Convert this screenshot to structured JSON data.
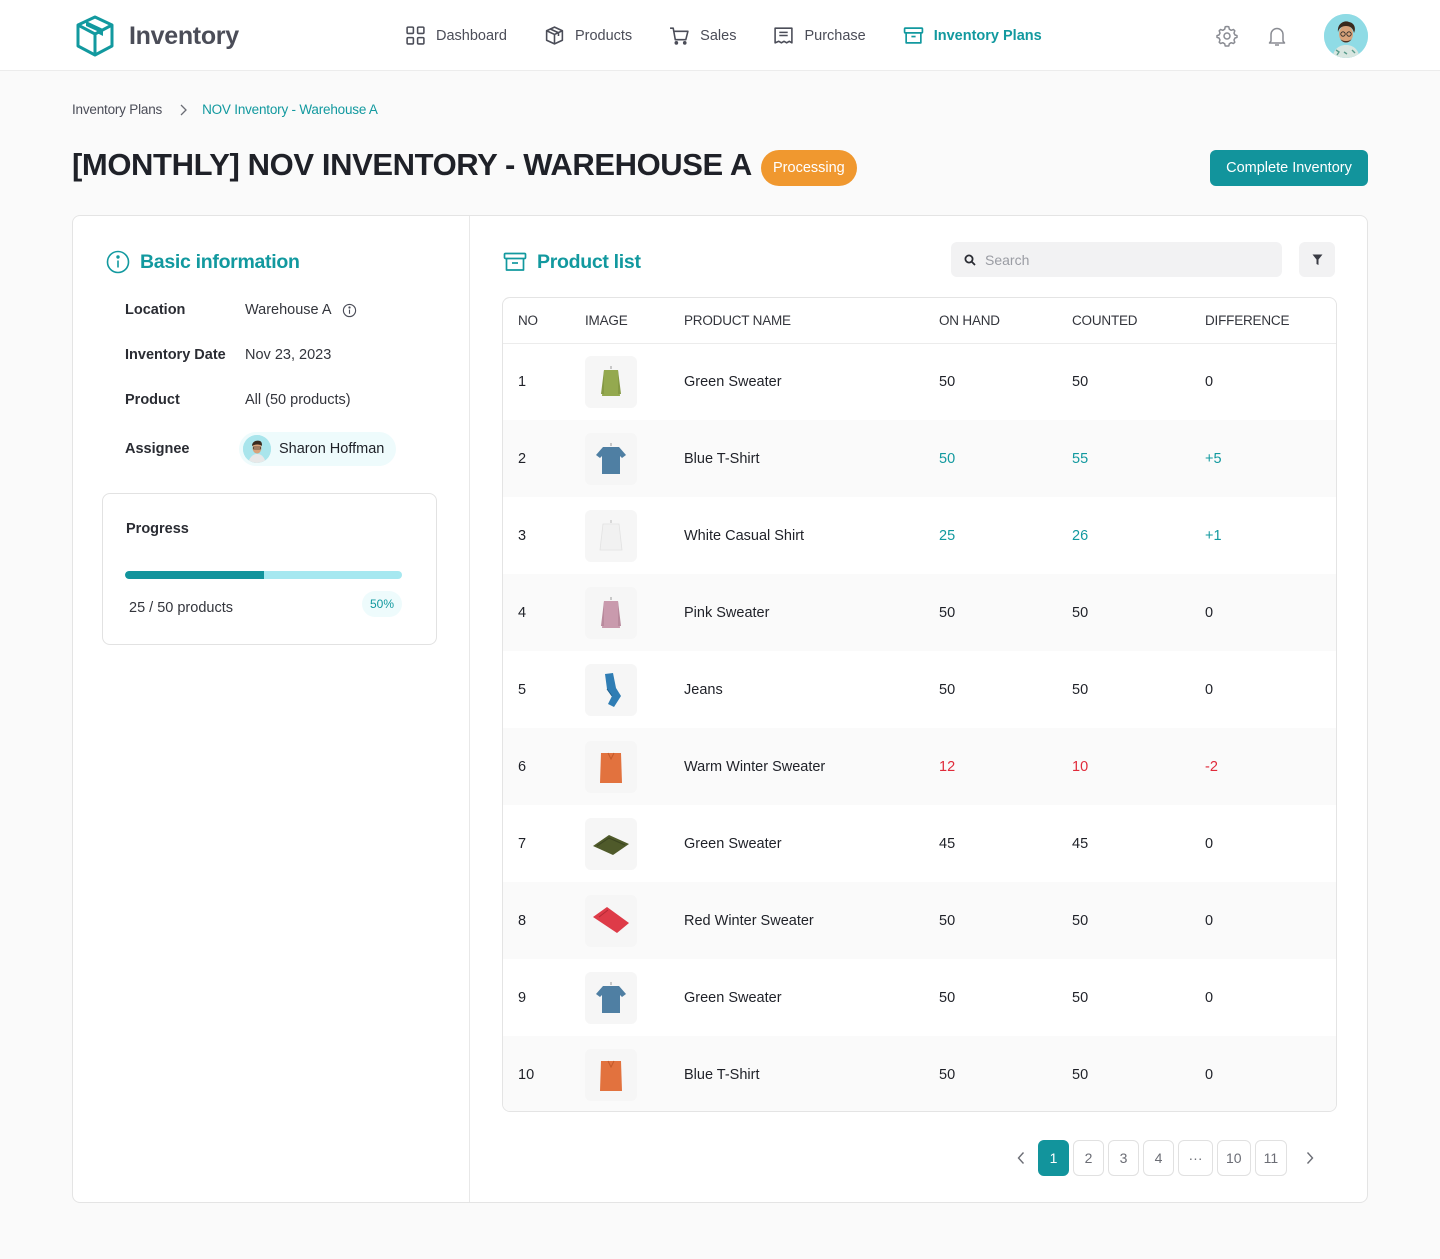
{
  "app": {
    "title": "Inventory",
    "brand_color": "#12999f"
  },
  "nav": {
    "items": [
      {
        "label": "Dashboard",
        "icon": "grid-icon",
        "active": false
      },
      {
        "label": "Products",
        "icon": "box-icon",
        "active": false
      },
      {
        "label": "Sales",
        "icon": "cart-icon",
        "active": false
      },
      {
        "label": "Purchase",
        "icon": "receipt-icon",
        "active": false
      },
      {
        "label": "Inventory Plans",
        "icon": "archive-icon",
        "active": true
      }
    ],
    "settings_icon": "gear-icon",
    "notifications_icon": "bell-icon",
    "user_avatar": "avatar"
  },
  "breadcrumb": {
    "items": [
      "Inventory Plans",
      "NOV Inventory - Warehouse A"
    ]
  },
  "header": {
    "title": "[MONTHLY] NOV INVENTORY - WAREHOUSE A",
    "status": "Processing",
    "status_color": "#f0982f",
    "action_label": "Complete Inventory"
  },
  "basic_info": {
    "title": "Basic information",
    "fields": [
      {
        "label": "Location",
        "value": "Warehouse A"
      },
      {
        "label": "Inventory Date",
        "value": "Nov 23, 2023"
      },
      {
        "label": "Product",
        "value": "All (50 products)"
      },
      {
        "label": "Assignee",
        "value": "Sharon Hoffman"
      }
    ],
    "progress": {
      "title": "Progress",
      "done": 25,
      "total": 50,
      "text": "25 / 50 products",
      "percent_label": "50%",
      "fraction": 0.5
    }
  },
  "product_list": {
    "title": "Product list",
    "search_placeholder": "Search",
    "columns": [
      "NO",
      "IMAGE",
      "PRODUCT NAME",
      "ON HAND",
      "COUNTED",
      "DIFFERENCE"
    ],
    "rows": [
      {
        "no": "1",
        "image": "green-sweater-hanging",
        "name": "Green Sweater",
        "on_hand": "50",
        "counted": "50",
        "difference": "0",
        "state": "neutral"
      },
      {
        "no": "2",
        "image": "blue-tshirt-hanging",
        "name": "Blue T-Shirt",
        "on_hand": "50",
        "counted": "55",
        "difference": "+5",
        "state": "pos"
      },
      {
        "no": "3",
        "image": "white-shirt-hanging",
        "name": "White Casual Shirt",
        "on_hand": "25",
        "counted": "26",
        "difference": "+1",
        "state": "pos"
      },
      {
        "no": "4",
        "image": "pink-sweater-hanging",
        "name": "Pink Sweater",
        "on_hand": "50",
        "counted": "50",
        "difference": "0",
        "state": "neutral"
      },
      {
        "no": "5",
        "image": "jeans-folded",
        "name": "Jeans",
        "on_hand": "50",
        "counted": "50",
        "difference": "0",
        "state": "neutral"
      },
      {
        "no": "6",
        "image": "orange-sweater-folded",
        "name": "Warm Winter Sweater",
        "on_hand": "12",
        "counted": "10",
        "difference": "-2",
        "state": "neg"
      },
      {
        "no": "7",
        "image": "green-sweater-folded",
        "name": "Green Sweater",
        "on_hand": "45",
        "counted": "45",
        "difference": "0",
        "state": "neutral"
      },
      {
        "no": "8",
        "image": "red-sweater-folded",
        "name": "Red Winter Sweater",
        "on_hand": "50",
        "counted": "50",
        "difference": "0",
        "state": "neutral"
      },
      {
        "no": "9",
        "image": "blue-tshirt-hanging",
        "name": "Green Sweater",
        "on_hand": "50",
        "counted": "50",
        "difference": "0",
        "state": "neutral"
      },
      {
        "no": "10",
        "image": "orange-sweater-folded",
        "name": "Blue T-Shirt",
        "on_hand": "50",
        "counted": "50",
        "difference": "0",
        "state": "neutral"
      }
    ],
    "status_colors": {
      "pos": "#12999f",
      "neg": "#e02a3a"
    }
  },
  "pagination": {
    "pages": [
      "1",
      "2",
      "3",
      "4",
      "...",
      "10",
      "11"
    ],
    "current": "1"
  }
}
